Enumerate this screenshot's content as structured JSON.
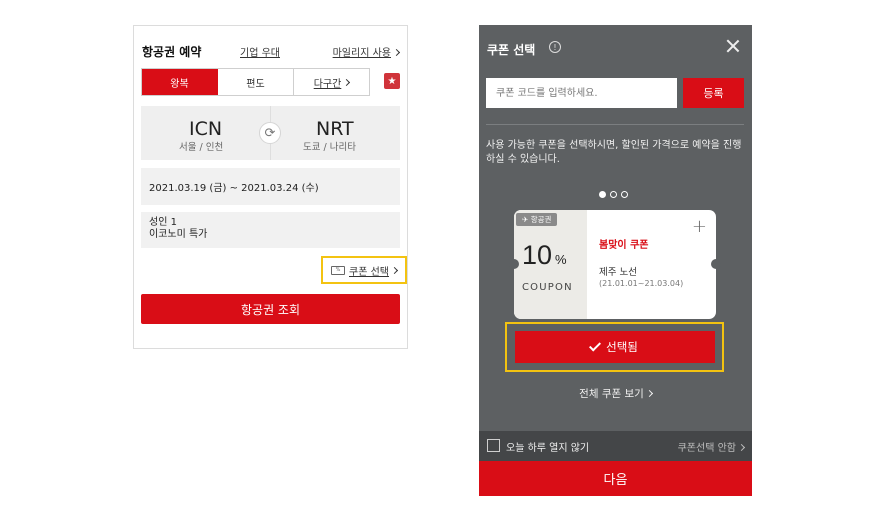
{
  "left": {
    "title": "항공권 예약",
    "corporate_link": "기업 우대",
    "mileage_link": "마일리지 사용",
    "tabs": [
      {
        "label": "왕복",
        "active": true
      },
      {
        "label": "편도",
        "active": false
      },
      {
        "label": "다구간",
        "active": false
      }
    ],
    "favorite_icon": "star-icon",
    "origin": {
      "code": "ICN",
      "city": "서울 / 인천"
    },
    "destination": {
      "code": "NRT",
      "city": "도쿄 / 나리타"
    },
    "swap_icon": "refresh-icon",
    "dates": "2021.03.19 (금) ~ 2021.03.24 (수)",
    "passengers": "성인 1",
    "cabin": "이코노미 특가",
    "coupon_select_link": "쿠폰 선택",
    "coupon_icon": "coupon-icon",
    "search_button": "항공권 조회"
  },
  "modal": {
    "title": "쿠폰 선택",
    "info_icon": "info-icon",
    "close_icon": "close-icon",
    "code_placeholder": "쿠폰 코드를 입력하세요.",
    "register_button": "등록",
    "description": "사용 가능한 쿠폰을 선택하시면, 할인된 가격으로 예약을 진행하실 수 있습니다.",
    "pagination": {
      "current": 1,
      "total": 3
    },
    "coupon": {
      "badge": "항공권",
      "badge_icon": "airplane-icon",
      "discount": "10",
      "unit": "%",
      "label": "COUPON",
      "name": "봄맞이 쿠폰",
      "route": "제주 노선",
      "period": "(21.01.01~21.03.04)"
    },
    "selected_button": "선택됨",
    "view_all_link": "전체 쿠폰 보기",
    "dont_show_today": "오늘 하루 열지 않기",
    "no_coupon_link": "쿠폰선택 안함",
    "next_button": "다음"
  },
  "colors": {
    "brand_red": "#d90d16",
    "highlight_yellow": "#f3c311",
    "modal_bg": "#5d6062"
  }
}
